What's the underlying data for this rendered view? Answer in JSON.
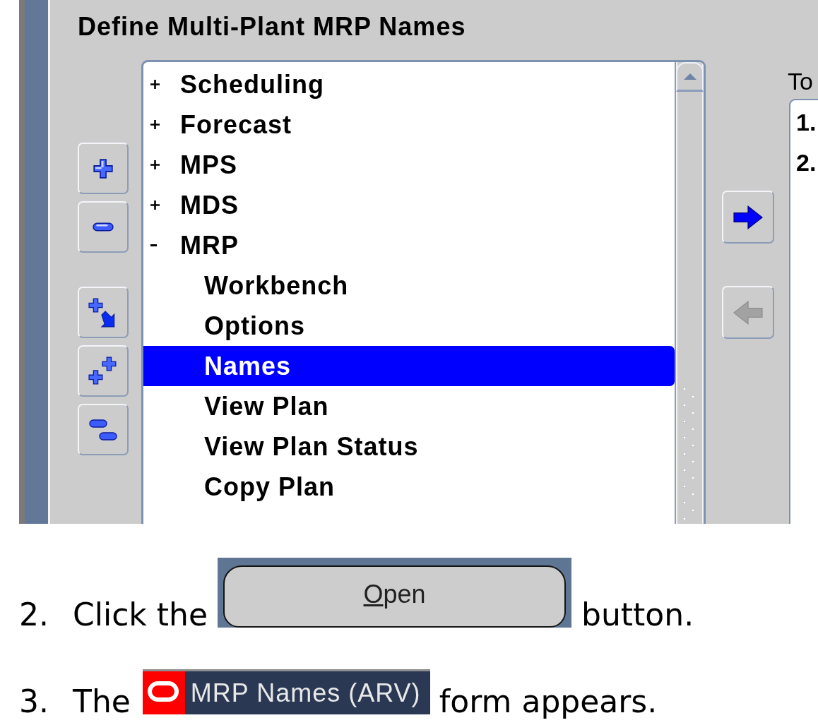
{
  "form": {
    "title": "Define Multi-Plant MRP Names",
    "tree": {
      "items": [
        {
          "label": "Scheduling",
          "expanded": false,
          "selected": false
        },
        {
          "label": "Forecast",
          "expanded": false,
          "selected": false
        },
        {
          "label": "MPS",
          "expanded": false,
          "selected": false
        },
        {
          "label": "MDS",
          "expanded": false,
          "selected": false
        },
        {
          "label": "MRP",
          "expanded": true,
          "selected": false,
          "children": [
            {
              "label": "Workbench",
              "selected": false
            },
            {
              "label": "Options",
              "selected": false
            },
            {
              "label": "Names",
              "selected": true
            },
            {
              "label": "View Plan",
              "selected": false
            },
            {
              "label": "View Plan Status",
              "selected": false
            },
            {
              "label": "Copy Plan",
              "selected": false
            }
          ]
        }
      ]
    },
    "move_right": {
      "disabled": false
    },
    "move_left": {
      "disabled": true
    },
    "target_list": {
      "label": "To",
      "items": [
        {
          "label": "1.",
          "selected": false
        },
        {
          "label": "2.",
          "selected": false
        }
      ]
    }
  },
  "steps": [
    {
      "number": "2.",
      "before": "Click the",
      "inset": {
        "kind": "button",
        "label": "Open",
        "mnemonic": true
      },
      "after": "button."
    },
    {
      "number": "3.",
      "before": "The",
      "inset": {
        "kind": "title_bar",
        "title": "MRP Names (ARV)"
      },
      "after": "form appears."
    }
  ]
}
